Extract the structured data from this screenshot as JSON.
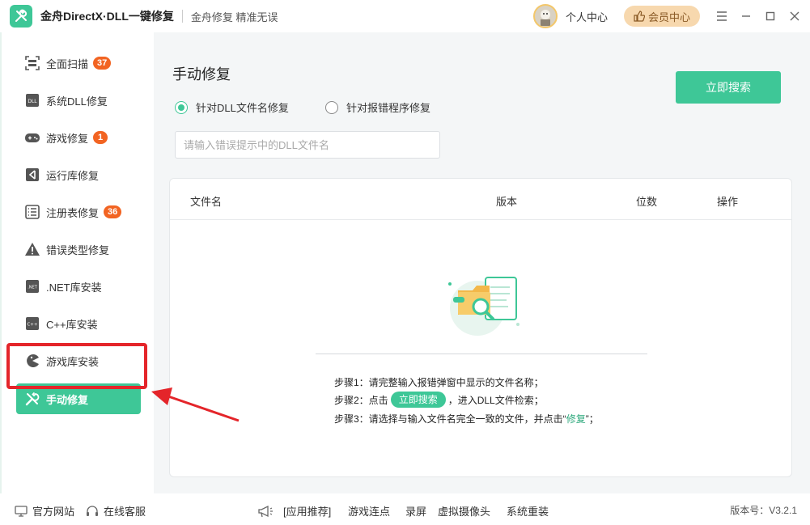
{
  "app": {
    "title": "金舟DirectX·DLL一键修复",
    "slogan": "金舟修复 精准无误",
    "user_center": "个人中心",
    "vip_center": "会员中心"
  },
  "sidebar": {
    "items": [
      {
        "label": "全面扫描",
        "badge": "37",
        "icon": "scan-icon"
      },
      {
        "label": "系统DLL修复",
        "badge": "",
        "icon": "dll-icon"
      },
      {
        "label": "游戏修复",
        "badge": "1",
        "icon": "gamepad-icon"
      },
      {
        "label": "运行库修复",
        "badge": "",
        "icon": "runtime-icon"
      },
      {
        "label": "注册表修复",
        "badge": "36",
        "icon": "registry-icon"
      },
      {
        "label": "错误类型修复",
        "badge": "",
        "icon": "warning-icon"
      },
      {
        "label": ".NET库安装",
        "badge": "",
        "icon": "dotnet-icon"
      },
      {
        "label": "C++库安装",
        "badge": "",
        "icon": "cpp-icon"
      },
      {
        "label": "游戏库安装",
        "badge": "",
        "icon": "pacman-icon"
      },
      {
        "label": "手动修复",
        "badge": "",
        "icon": "wrench-icon",
        "active": true
      }
    ]
  },
  "main": {
    "title": "手动修复",
    "search_button": "立即搜索",
    "radio_dll_name": "针对DLL文件名修复",
    "radio_program": "针对报错程序修复",
    "input_placeholder": "请输入错误提示中的DLL文件名",
    "input_value": "",
    "columns": [
      "文件名",
      "版本",
      "位数",
      "操作"
    ],
    "steps": {
      "s1": "步骤1：请完整输入报错弹窗中显示的文件名称；",
      "s2_prefix": "步骤2：点击",
      "s2_chip": "立即搜索",
      "s2_suffix": "，进入DLL文件检索；",
      "s3_prefix": "步骤3：请选择与输入文件名完全一致的文件，并点击“",
      "s3_link": "修复",
      "s3_suffix": "”；"
    }
  },
  "footer": {
    "official_site": "官方网站",
    "online_service": "在线客服",
    "recommend": "[应用推荐]",
    "links": [
      "游戏连点",
      "录屏",
      "虚拟摄像头",
      "系统重装"
    ],
    "version": "版本号：V3.2.1"
  },
  "colors": {
    "accent": "#3ec797",
    "badge": "#f26422",
    "highlight": "#e4252a",
    "vip_bg": "#f7d8ae"
  }
}
